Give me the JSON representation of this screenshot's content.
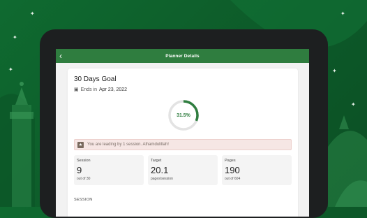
{
  "appbar": {
    "title": "Planner Details",
    "back_icon": "chevron-left-icon"
  },
  "goal": {
    "title": "30 Days Goal",
    "ends_prefix": "Ends in",
    "ends_date": "Apr 23, 2022",
    "progress_label": "31.5%",
    "progress_fraction": 0.315
  },
  "banner": {
    "message": "You are leading by 1 session. Alhamdulillah!"
  },
  "stats": [
    {
      "label": "Session",
      "value": "9",
      "sub": "out of 30"
    },
    {
      "label": "Target",
      "value": "20.1",
      "sub": "pages/session"
    },
    {
      "label": "Pages",
      "value": "190",
      "sub": "out of 604"
    }
  ],
  "section_heading": "SESSION",
  "colors": {
    "primary": "#2f7d3f",
    "background": "#0f6a30",
    "banner_bg": "#f6e6e4"
  }
}
